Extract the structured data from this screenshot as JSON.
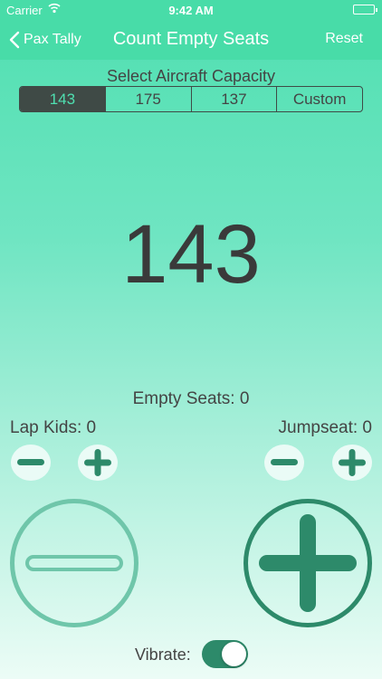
{
  "status_bar": {
    "carrier": "Carrier",
    "time": "9:42 AM"
  },
  "nav": {
    "back_label": "Pax Tally",
    "title": "Count Empty Seats",
    "reset_label": "Reset"
  },
  "capacity": {
    "label": "Select Aircraft Capacity",
    "options": [
      "143",
      "175",
      "137",
      "Custom"
    ],
    "selected": "143"
  },
  "counter": {
    "value": "143"
  },
  "empty_seats": {
    "label": "Empty Seats: 0"
  },
  "lap_kids": {
    "label": "Lap Kids: 0"
  },
  "jumpseat": {
    "label": "Jumpseat: 0"
  },
  "vibrate": {
    "label": "Vibrate:",
    "on": true
  },
  "colors": {
    "header": "#48dca8",
    "accent_dark": "#2d8a6a",
    "accent_light": "#6fc6aa",
    "selected_segment": "#3f4a46"
  }
}
